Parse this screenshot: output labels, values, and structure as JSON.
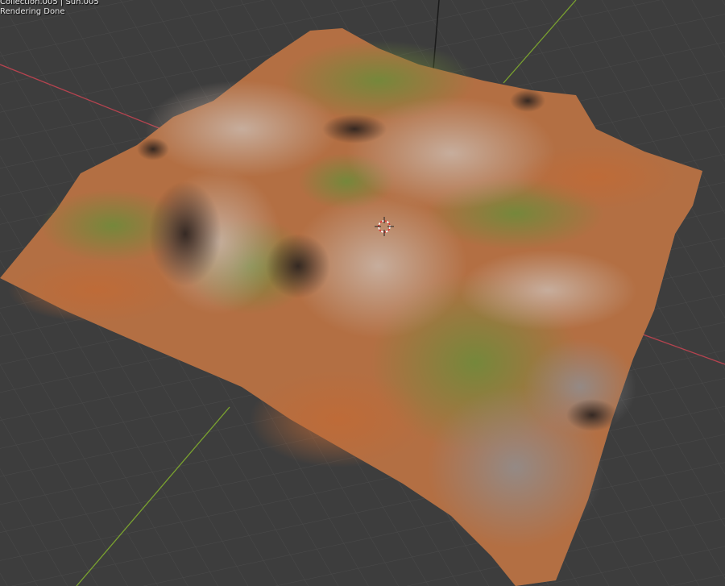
{
  "viewport": {
    "info_text": "Collection.005 | Sun.005",
    "status_text": "Rendering Done",
    "colors": {
      "background": "#3d3d3d",
      "grid_line": "#4a4a4a",
      "x_axis": "#b5434f",
      "y_axis": "#7aa22f"
    },
    "object": "terrain-mesh",
    "icons": [
      "3d-cursor-icon"
    ]
  }
}
